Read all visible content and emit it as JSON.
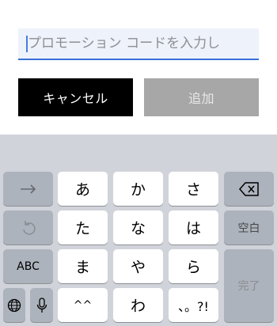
{
  "promo": {
    "placeholder": "プロモーション コードを入力し"
  },
  "buttons": {
    "cancel_label": "キャンセル",
    "add_label": "追加"
  },
  "keyboard": {
    "row1": {
      "col1": "あ",
      "col2": "か",
      "col3": "さ"
    },
    "row2": {
      "col1": "た",
      "col2": "な",
      "col3": "は",
      "space_label": "空白"
    },
    "row3": {
      "abc_label": "ABC",
      "col1": "ま",
      "col2": "や",
      "col3": "ら",
      "done_label": "完了"
    },
    "row4": {
      "col1": "^^",
      "col2": "わ",
      "col3": "、。?!"
    },
    "icons": [
      "next-arrow-icon",
      "backspace-icon",
      "undo-icon",
      "globe-icon",
      "microphone-icon"
    ]
  },
  "colors": {
    "accent": "#3a6fd8",
    "cancel_bg": "#000000",
    "add_bg": "#a7a7a7",
    "keyboard_bg": "#d0d3d9"
  }
}
